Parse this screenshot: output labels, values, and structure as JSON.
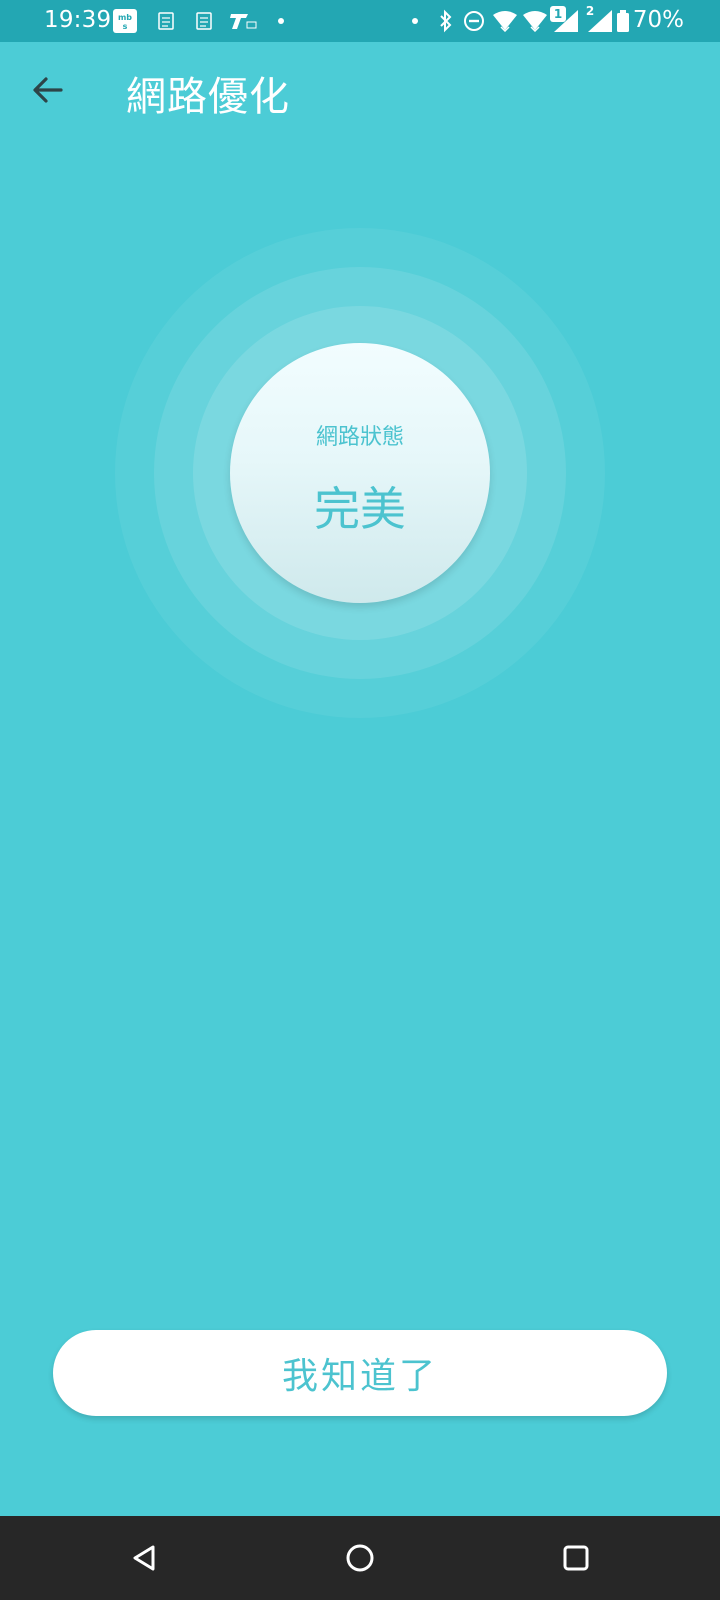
{
  "status_bar": {
    "time": "19:39",
    "battery_text": "70%",
    "sim1_label": "1",
    "sim2_label": "2",
    "notification_icons": [
      "mbs-icon",
      "sim-card-icon",
      "sim-card-icon",
      "t-app-icon"
    ],
    "system_icons": [
      "bluetooth-icon",
      "do-not-disturb-icon",
      "wifi-icon",
      "wifi-icon",
      "signal-icon",
      "signal-icon",
      "battery-icon"
    ]
  },
  "header": {
    "title": "網路優化"
  },
  "status": {
    "label": "網路狀態",
    "value": "完美"
  },
  "actions": {
    "confirm_label": "我知道了"
  },
  "colors": {
    "background": "#4cccd6",
    "status_bar": "#23a7b3",
    "accent_text": "#4cc3cf",
    "nav_bar": "#272727"
  }
}
